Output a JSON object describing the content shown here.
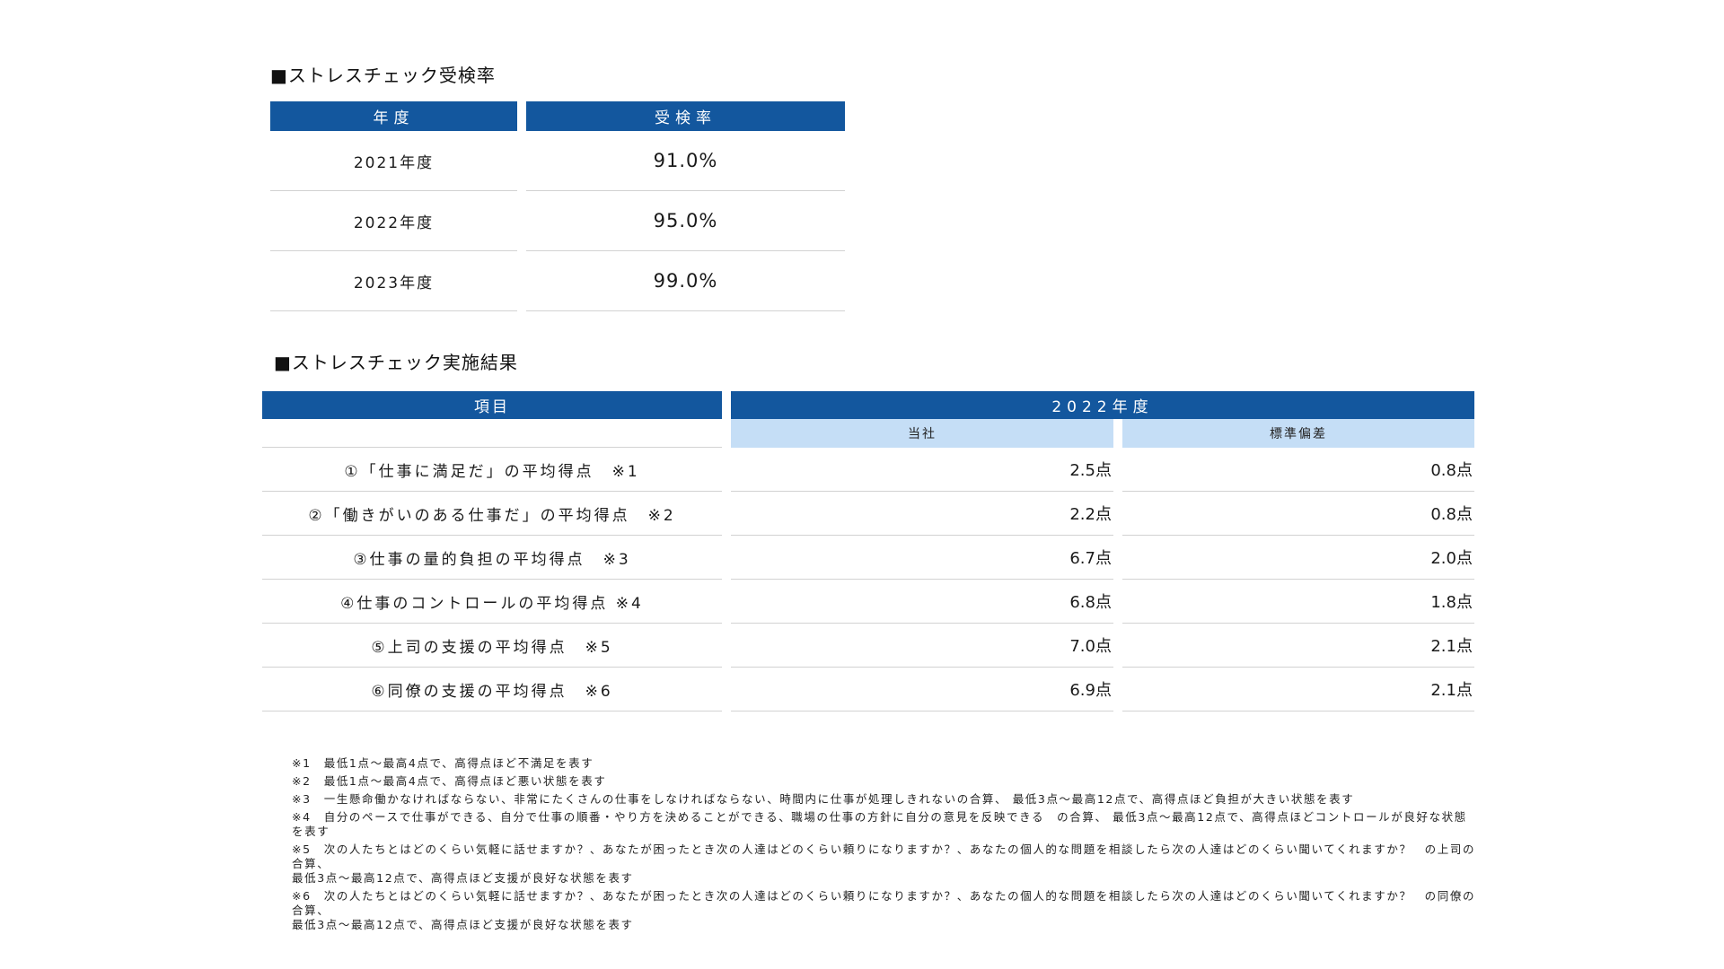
{
  "section1": {
    "title": "■ストレスチェック受検率",
    "headers": {
      "year": "年度",
      "rate": "受検率"
    },
    "rows": [
      {
        "year": "2021年度",
        "rate": "91.0%"
      },
      {
        "year": "2022年度",
        "rate": "95.0%"
      },
      {
        "year": "2023年度",
        "rate": "99.0%"
      }
    ]
  },
  "section2": {
    "title": "■ストレスチェック実施結果",
    "headers": {
      "item": "項目",
      "year": "2022年度",
      "company": "当社",
      "stddev": "標準偏差"
    },
    "rows": [
      {
        "item": "①「仕事に満足だ」の平均得点　※1",
        "company": "2.5点",
        "stddev": "0.8点"
      },
      {
        "item": "②「働きがいのある仕事だ」の平均得点　※2",
        "company": "2.2点",
        "stddev": "0.8点"
      },
      {
        "item": "③仕事の量的負担の平均得点　※3",
        "company": "6.7点",
        "stddev": "2.0点"
      },
      {
        "item": "④仕事のコントロールの平均得点 ※4",
        "company": "6.8点",
        "stddev": "1.8点"
      },
      {
        "item": "⑤上司の支援の平均得点　※5",
        "company": "7.0点",
        "stddev": "2.1点"
      },
      {
        "item": "⑥同僚の支援の平均得点　※6",
        "company": "6.9点",
        "stddev": "2.1点"
      }
    ]
  },
  "notes": [
    "※1　最低1点〜最高4点で、高得点ほど不満足を表す",
    "※2　最低1点〜最高4点で、高得点ほど悪い状態を表す",
    "※3　一生懸命働かなければならない、非常にたくさんの仕事をしなければならない、時間内に仕事が処理しきれないの合算、 最低3点〜最高12点で、高得点ほど負担が大きい状態を表す",
    "※4　自分のペースで仕事ができる、自分で仕事の順番・やり方を決めることができる、職場の仕事の方針に自分の意見を反映できる　の合算、 最低3点〜最高12点で、高得点ほどコントロールが良好な状態を表す",
    "※5　次の人たちとはどのくらい気軽に話せますか？、あなたが困ったとき次の人達はどのくらい頼りになりますか？、あなたの個人的な問題を相談したら次の人達はどのくらい聞いてくれますか？　の上司の合算、",
    " 最低3点〜最高12点で、高得点ほど支援が良好な状態を表す",
    "※6　次の人たちとはどのくらい気軽に話せますか？、あなたが困ったとき次の人達はどのくらい頼りになりますか？、あなたの個人的な問題を相談したら次の人達はどのくらい聞いてくれますか？　の同僚の合算、",
    " 最低3点〜最高12点で、高得点ほど支援が良好な状態を表す"
  ]
}
